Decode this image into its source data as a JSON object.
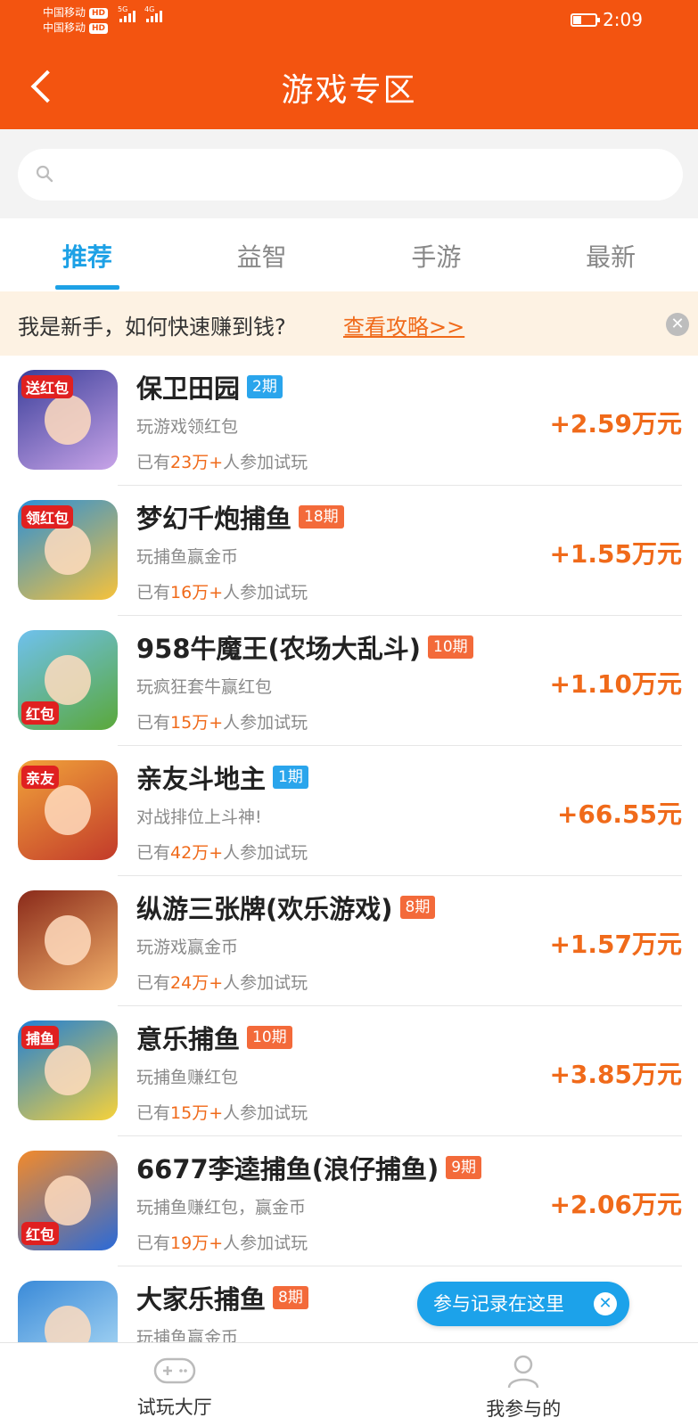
{
  "status_bar": {
    "carrier1": "中国移动",
    "carrier2": "中国移动",
    "hd": "HD",
    "net1": "5G",
    "net2": "4G",
    "time": "2:09",
    "battery_level": 0.35
  },
  "header": {
    "title": "游戏专区"
  },
  "search": {
    "placeholder": ""
  },
  "tabs": [
    {
      "label": "推荐",
      "active": true
    },
    {
      "label": "益智",
      "active": false
    },
    {
      "label": "手游",
      "active": false
    },
    {
      "label": "最新",
      "active": false
    }
  ],
  "notice": {
    "text": "我是新手，如何快速赚到钱?",
    "link": "查看攻略>>"
  },
  "games": [
    {
      "name": "保卫田园",
      "period": "2期",
      "period_color": "#2aa5ec",
      "desc": "玩游戏领红包",
      "players_prefix": "已有",
      "players_count": "23万+",
      "players_suffix": "人参加试玩",
      "reward": "+2.59万元",
      "icon_badge": "送红包",
      "icon_colors": [
        "#3b3f9a",
        "#c8a4e8"
      ]
    },
    {
      "name": "梦幻千炮捕鱼",
      "period": "18期",
      "period_color": "#f36a3a",
      "desc": "玩捕鱼赢金币",
      "players_prefix": "已有",
      "players_count": "16万+",
      "players_suffix": "人参加试玩",
      "reward": "+1.55万元",
      "icon_badge": "领红包",
      "icon_colors": [
        "#2a8fd8",
        "#f7c23a"
      ]
    },
    {
      "name": "958牛魔王(农场大乱斗)",
      "period": "10期",
      "period_color": "#f36a3a",
      "desc": "玩疯狂套牛赢红包",
      "players_prefix": "已有",
      "players_count": "15万+",
      "players_suffix": "人参加试玩",
      "reward": "+1.10万元",
      "icon_badge": "红包",
      "icon_colors": [
        "#6fc1ee",
        "#5aa83a"
      ]
    },
    {
      "name": "亲友斗地主",
      "period": "1期",
      "period_color": "#2aa5ec",
      "desc": "对战排位上斗神!",
      "players_prefix": "已有",
      "players_count": "42万+",
      "players_suffix": "人参加试玩",
      "reward": "+66.55元",
      "icon_badge": "亲友",
      "icon_colors": [
        "#f1a33a",
        "#c23a2a"
      ]
    },
    {
      "name": "纵游三张牌(欢乐游戏)",
      "period": "8期",
      "period_color": "#f36a3a",
      "desc": "玩游戏赢金币",
      "players_prefix": "已有",
      "players_count": "24万+",
      "players_suffix": "人参加试玩",
      "reward": "+1.57万元",
      "icon_badge": "",
      "icon_colors": [
        "#8a2a1a",
        "#f2b06a"
      ]
    },
    {
      "name": "意乐捕鱼",
      "period": "10期",
      "period_color": "#f36a3a",
      "desc": "玩捕鱼赚红包",
      "players_prefix": "已有",
      "players_count": "15万+",
      "players_suffix": "人参加试玩",
      "reward": "+3.85万元",
      "icon_badge": "捕鱼",
      "icon_colors": [
        "#1f7fd6",
        "#f7d23a"
      ]
    },
    {
      "name": "6677李逵捕鱼(浪仔捕鱼)",
      "period": "9期",
      "period_color": "#f36a3a",
      "desc": "玩捕鱼赚红包，赢金币",
      "players_prefix": "已有",
      "players_count": "19万+",
      "players_suffix": "人参加试玩",
      "reward": "+2.06万元",
      "icon_badge": "红包",
      "icon_colors": [
        "#f38a2a",
        "#2a6ad8"
      ]
    },
    {
      "name": "大家乐捕鱼",
      "period": "8期",
      "period_color": "#f36a3a",
      "desc": "玩捕鱼赢金币",
      "players_prefix": "",
      "players_count": "",
      "players_suffix": "",
      "reward": "",
      "icon_badge": "",
      "icon_colors": [
        "#3a8ad8",
        "#b8e2f8"
      ]
    }
  ],
  "floating_tip": {
    "text": "参与记录在这里",
    "close": "✕"
  },
  "bottom_nav": [
    {
      "label": "试玩大厅",
      "icon": "gamepad-icon"
    },
    {
      "label": "我参与的",
      "icon": "user-icon"
    }
  ]
}
